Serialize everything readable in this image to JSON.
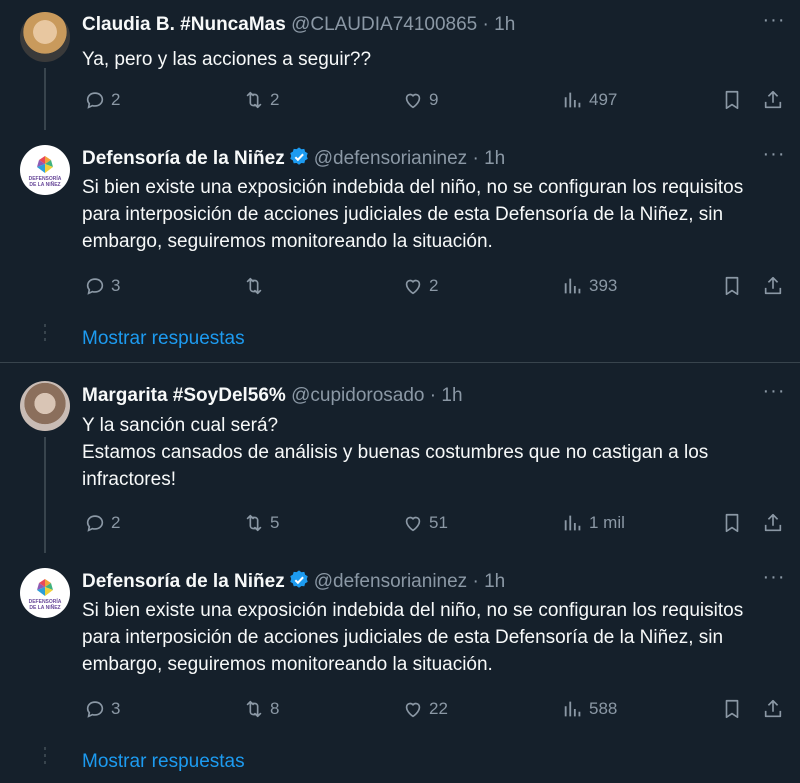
{
  "tweets": [
    {
      "name": "Claudia B. #NuncaMas",
      "handle": "@CLAUDIA74100865",
      "time": "· 1h",
      "verified": false,
      "avatar": "photo",
      "text": "Ya, pero y las acciones a seguir??",
      "replies": "2",
      "retweets": "2",
      "likes": "9",
      "views": "497"
    },
    {
      "name": "Defensoría de la Niñez",
      "handle": "@defensorianinez",
      "time": "· 1h",
      "verified": true,
      "avatar": "logo",
      "logo_text_1": "DEFENSORÍA",
      "logo_text_2": "DE LA NIÑEZ",
      "text": "Si bien existe una exposición indebida del niño, no se configuran los requisitos para interposición de acciones judiciales de esta Defensoría de la Niñez, sin embargo, seguiremos monitoreando la situación.",
      "replies": "3",
      "retweets": "",
      "likes": "2",
      "views": "393"
    },
    {
      "name": "Margarita #SoyDel56%",
      "handle": "@cupidorosado",
      "time": "· 1h",
      "verified": false,
      "avatar": "photo",
      "text_line1": "Y la sanción cual será?",
      "text_line2": "Estamos cansados de análisis y buenas costumbres que no castigan a los infractores!",
      "replies": "2",
      "retweets": "5",
      "likes": "51",
      "views": "1 mil"
    },
    {
      "name": "Defensoría de la Niñez",
      "handle": "@defensorianinez",
      "time": "· 1h",
      "verified": true,
      "avatar": "logo",
      "logo_text_1": "DEFENSORÍA",
      "logo_text_2": "DE LA NIÑEZ",
      "text": "Si bien existe una exposición indebida del niño, no se configuran los requisitos para interposición de acciones judiciales de esta Defensoría de la Niñez, sin embargo, seguiremos monitoreando la situación.",
      "replies": "3",
      "retweets": "8",
      "likes": "22",
      "views": "588"
    }
  ],
  "show_replies": "Mostrar respuestas",
  "colors": {
    "background": "#15202b",
    "text": "#f7f9f9",
    "muted": "#8b98a5",
    "link": "#1d9bf0",
    "verified": "#1d9bf0",
    "line": "#38444d"
  },
  "icons": [
    "reply-icon",
    "retweet-icon",
    "like-icon",
    "views-icon",
    "bookmark-icon",
    "share-icon",
    "more-icon",
    "verified-badge-icon"
  ]
}
